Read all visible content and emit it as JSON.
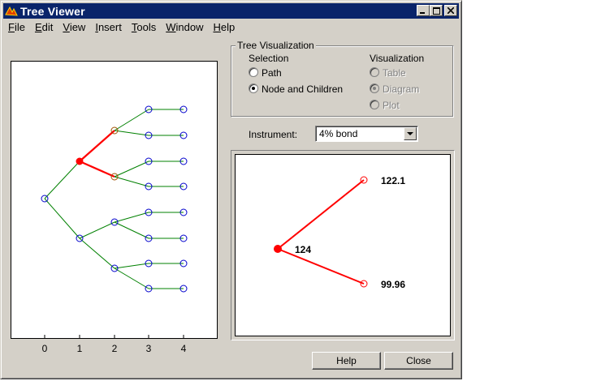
{
  "window": {
    "title": "Tree Viewer"
  },
  "menu": [
    {
      "label": "File",
      "accel": "F",
      "rest": "ile"
    },
    {
      "label": "Edit",
      "accel": "E",
      "rest": "dit"
    },
    {
      "label": "View",
      "accel": "V",
      "rest": "iew"
    },
    {
      "label": "Insert",
      "accel": "I",
      "rest": "nsert"
    },
    {
      "label": "Tools",
      "accel": "T",
      "rest": "ools"
    },
    {
      "label": "Window",
      "accel": "W",
      "rest": "indow"
    },
    {
      "label": "Help",
      "accel": "H",
      "rest": "elp"
    }
  ],
  "tree_plot": {
    "x_ticks": [
      "0",
      "1",
      "2",
      "3",
      "4"
    ],
    "highlight_color": "#ff0000",
    "edge_color": "#008000",
    "node_color": "#0000cc",
    "selected_node": "level 1, upper branch"
  },
  "visualization_panel": {
    "title": "Tree Visualization",
    "selection_heading": "Selection",
    "selection_options": [
      {
        "label": "Path",
        "selected": false
      },
      {
        "label": "Node and Children",
        "selected": true
      }
    ],
    "visualization_heading": "Visualization",
    "visualization_options": [
      {
        "label": "Table",
        "selected": false,
        "enabled": false
      },
      {
        "label": "Diagram",
        "selected": true,
        "enabled": false
      },
      {
        "label": "Plot",
        "selected": false,
        "enabled": false
      }
    ]
  },
  "instrument": {
    "label": "Instrument:",
    "selected": "4% bond"
  },
  "diagram": {
    "parent_value": "124",
    "children": [
      "122.1",
      "99.96"
    ]
  },
  "buttons": {
    "help": "Help",
    "close": "Close"
  }
}
